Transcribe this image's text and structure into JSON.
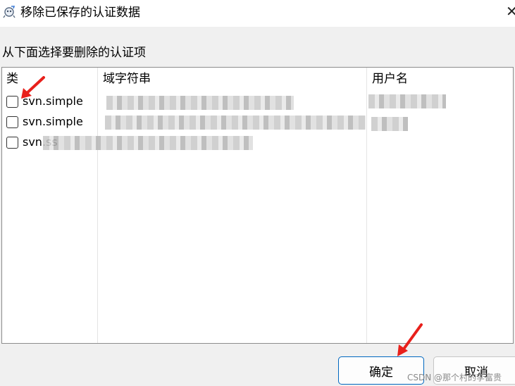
{
  "window": {
    "title": "移除已保存的认证数据",
    "close_glyph": "✕"
  },
  "instruction": "从下面选择要删除的认证项",
  "table": {
    "columns": [
      "类",
      "域字符串",
      "用户名"
    ],
    "rows": [
      {
        "type": "svn.simple",
        "checked": false
      },
      {
        "type": "svn.simple",
        "checked": false
      },
      {
        "type": "svn.ss",
        "checked": false
      }
    ]
  },
  "buttons": {
    "ok": "确定",
    "cancel": "取消"
  },
  "watermark": "CSDN @那个村的李富贵",
  "annotation_color": "#e8201b",
  "icons": [
    "app-icon",
    "close-icon",
    "arrow-icon"
  ]
}
